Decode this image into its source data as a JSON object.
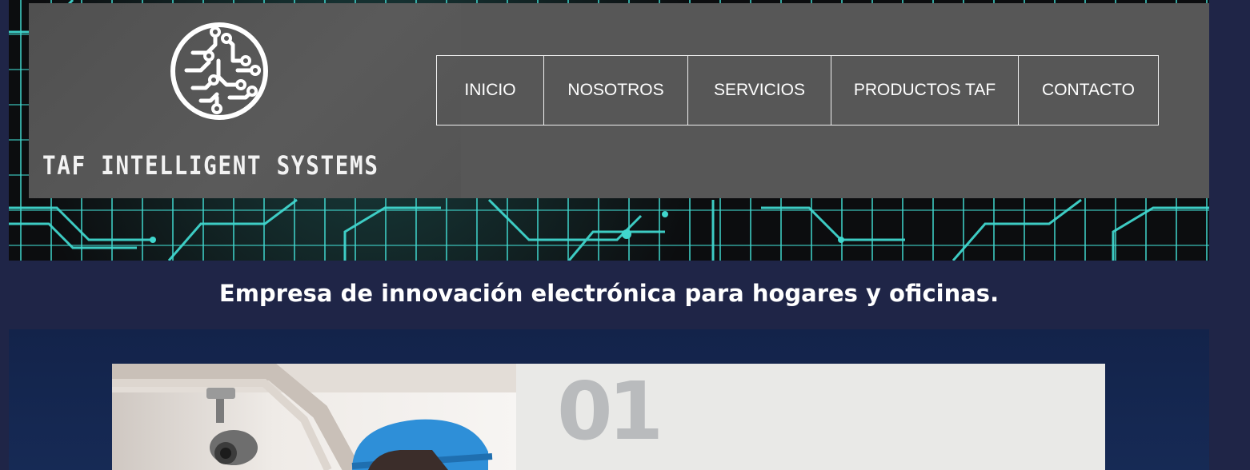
{
  "brand": {
    "name": "TAF INTELLIGENT SYSTEMS",
    "logo_icon": "circuit-globe-icon"
  },
  "nav": {
    "items": [
      {
        "label": "INICIO"
      },
      {
        "label": "NOSOTROS"
      },
      {
        "label": "SERVICIOS"
      },
      {
        "label": "PRODUCTOS TAF"
      },
      {
        "label": "CONTACTO"
      }
    ]
  },
  "tagline": "Empresa de innovación electrónica para hogares y oficinas.",
  "feature": {
    "number": "01"
  },
  "colors": {
    "page_background": "#1f2547",
    "header_panel": "#575757",
    "circuit_accent": "#40d6cd",
    "feature_card": "#e9e9e7",
    "feature_number": "#b9bbbd",
    "helmet": "#2e8fd8"
  }
}
